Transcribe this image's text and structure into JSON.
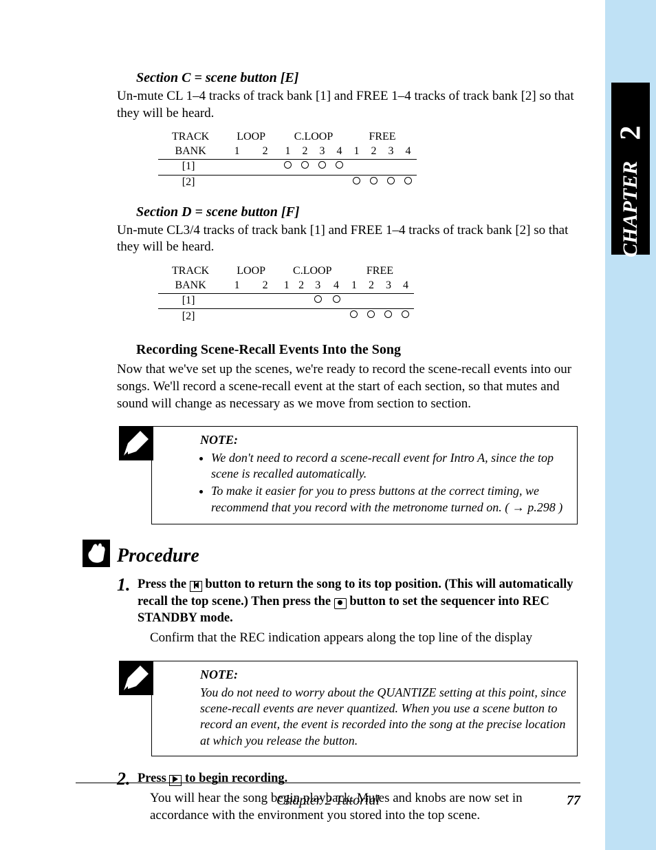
{
  "sidebar": {
    "chapter_number": "2",
    "chapter_label": "CHAPTER"
  },
  "section_c": {
    "heading": "Section C = scene button [E]",
    "text": "Un-mute CL 1–4 tracks of track bank [1] and FREE 1–4 tracks of track bank [2] so that they will be heard."
  },
  "section_d": {
    "heading": "Section D = scene button [F]",
    "text": "Un-mute CL3/4 tracks of track bank [1] and FREE 1–4 tracks of track bank [2] so that they will be heard."
  },
  "tables": {
    "head": {
      "track": "TRACK",
      "bank": "BANK",
      "loop": "LOOP",
      "cloop": "C.LOOP",
      "free": "FREE",
      "loop_cols": [
        "1",
        "2"
      ],
      "four_cols": [
        "1",
        "2",
        "3",
        "4"
      ]
    },
    "rows": {
      "r1": "[1]",
      "r2": "[2]"
    },
    "c_data": {
      "row1": {
        "loop": [
          false,
          false
        ],
        "cloop": [
          true,
          true,
          true,
          true
        ],
        "free": [
          false,
          false,
          false,
          false
        ]
      },
      "row2": {
        "loop": [
          false,
          false
        ],
        "cloop": [
          false,
          false,
          false,
          false
        ],
        "free": [
          true,
          true,
          true,
          true
        ]
      }
    },
    "d_data": {
      "row1": {
        "loop": [
          false,
          false
        ],
        "cloop": [
          false,
          false,
          true,
          true
        ],
        "free": [
          false,
          false,
          false,
          false
        ]
      },
      "row2": {
        "loop": [
          false,
          false
        ],
        "cloop": [
          false,
          false,
          false,
          false
        ],
        "free": [
          true,
          true,
          true,
          true
        ]
      }
    }
  },
  "recording": {
    "heading": "Recording Scene-Recall Events Into the Song",
    "text": "Now that we've set up the scenes, we're ready to record the scene-recall events into our songs. We'll record a scene-recall event at the start of each section, so that mutes and sound will change as necessary as we move from section to section."
  },
  "note1": {
    "label": "NOTE:",
    "items": [
      "We don't need to record a scene-recall event for Intro A, since the top scene is recalled automatically.",
      "To make it easier for you to press buttons at the correct timing, we recommend that you record with the metronome turned on. ( → p.298 )"
    ]
  },
  "procedure": {
    "heading": "Procedure",
    "step1": {
      "num": "1.",
      "lead_a": "Press the ",
      "lead_b": " button to return the song to its top position. (This will automatically recall the top scene.) Then press the ",
      "lead_c": " button to set the sequencer into REC STANDBY mode.",
      "body": "Confirm that the REC indication appears along the top line of the display"
    },
    "step2": {
      "num": "2.",
      "lead_a": "Press ",
      "lead_b": " to begin recording.",
      "body": "You will hear the song begin playback. Mutes and knobs are now set in accordance with the environment you stored into the top scene."
    }
  },
  "note2": {
    "label": "NOTE:",
    "body": "You do not need to worry about the QUANTIZE setting at this point, since scene-recall events are never quantized. When you use a scene button to record an event, the event is recorded into the song at the precise location at which you release the button."
  },
  "footer": {
    "text": "Chapter 2   Tutorial",
    "page": "77"
  }
}
